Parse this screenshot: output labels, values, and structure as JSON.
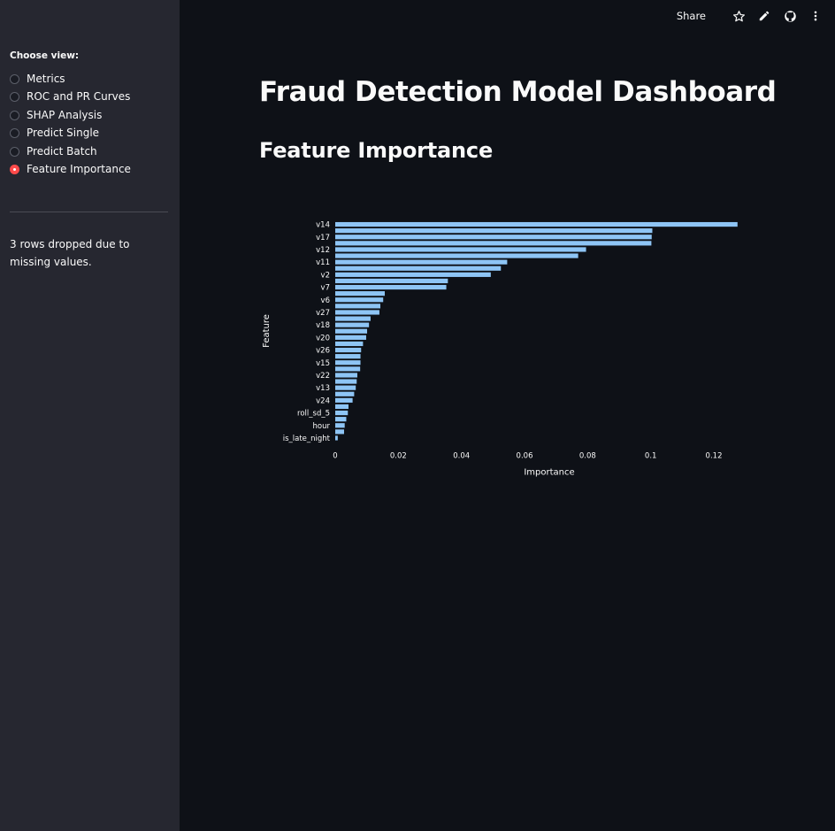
{
  "sidebar": {
    "title": "Choose view:",
    "options": [
      "Metrics",
      "ROC and PR Curves",
      "SHAP Analysis",
      "Predict Single",
      "Predict Batch",
      "Feature Importance"
    ],
    "selected_index": 5,
    "message": "3 rows dropped due to missing values."
  },
  "toolbar": {
    "share_label": "Share",
    "icons": [
      "star-icon",
      "pencil-icon",
      "github-icon",
      "more-vert-icon"
    ]
  },
  "page": {
    "title": "Fraud Detection Model Dashboard",
    "subtitle": "Feature Importance"
  },
  "colors": {
    "background": "#0e1117",
    "sidebar": "#262730",
    "accent": "#ff4b4b",
    "bar": "#8ec5f5"
  },
  "chart_data": {
    "type": "bar",
    "orientation": "horizontal",
    "xlabel": "Importance",
    "ylabel": "Feature",
    "xlim": [
      0,
      0.127
    ],
    "xticks": [
      0,
      0.02,
      0.04,
      0.06,
      0.08,
      0.1,
      0.12
    ],
    "xtick_labels": [
      "0",
      "0.02",
      "0.04",
      "0.06",
      "0.08",
      "0.1",
      "0.12"
    ],
    "categories": [
      "v14",
      "",
      "v17",
      "",
      "v12",
      "",
      "v11",
      "",
      "v2",
      "",
      "v7",
      "",
      "v6",
      "",
      "v27",
      "",
      "v18",
      "",
      "v20",
      "",
      "v26",
      "",
      "v15",
      "",
      "v22",
      "",
      "v13",
      "",
      "v24",
      "",
      "roll_sd_5",
      "",
      "hour",
      "",
      "is_late_night"
    ],
    "values": [
      0.1275,
      0.1005,
      0.1003,
      0.1002,
      0.0795,
      0.077,
      0.0545,
      0.0525,
      0.0493,
      0.0357,
      0.0352,
      0.0157,
      0.0152,
      0.0143,
      0.014,
      0.0112,
      0.0107,
      0.0101,
      0.0098,
      0.0088,
      0.0082,
      0.008,
      0.008,
      0.0079,
      0.007,
      0.0068,
      0.0065,
      0.006,
      0.0055,
      0.0042,
      0.004,
      0.0035,
      0.003,
      0.0028,
      0.0008
    ]
  }
}
